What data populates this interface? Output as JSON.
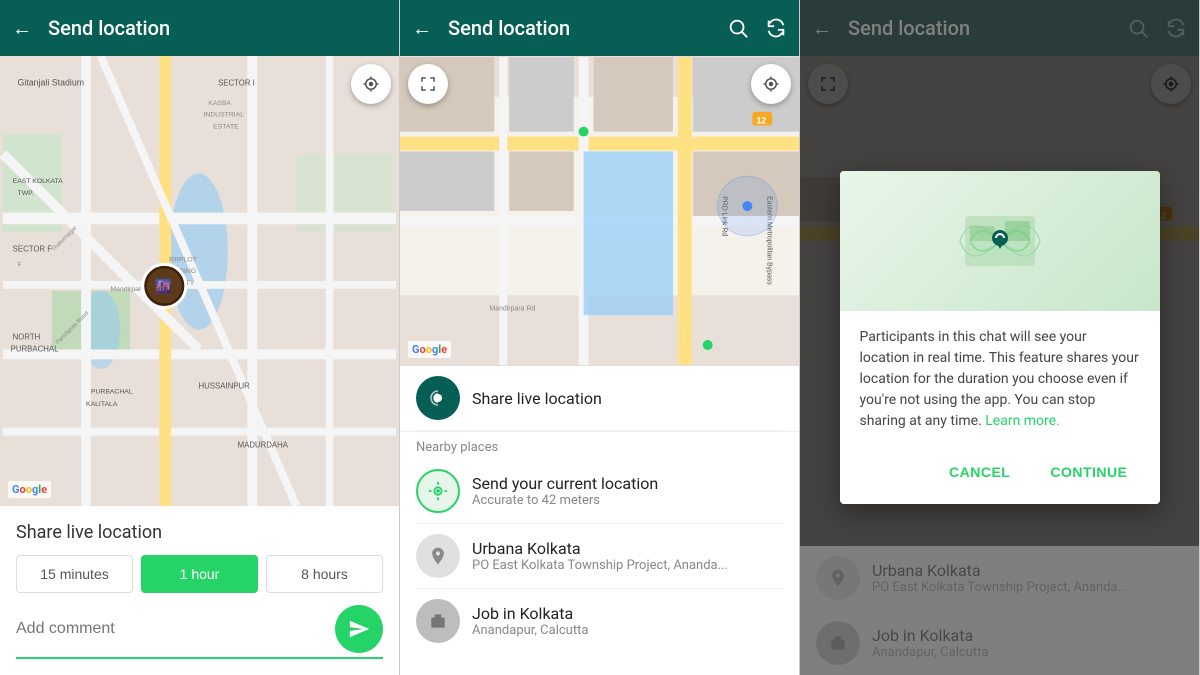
{
  "panel_left": {
    "header": {
      "title": "Send location",
      "back_icon": "←"
    },
    "section_title": "Share live location",
    "duration_options": [
      {
        "label": "15 minutes",
        "active": false
      },
      {
        "label": "1 hour",
        "active": true
      },
      {
        "label": "8 hours",
        "active": false
      }
    ],
    "comment_placeholder": "Add comment",
    "send_icon": "▶"
  },
  "panel_mid": {
    "header": {
      "title": "Send location",
      "back_icon": "←",
      "search_icon": "search",
      "refresh_icon": "refresh"
    },
    "live_location_label": "Share live location",
    "nearby_label": "Nearby places",
    "current_location": {
      "label": "Send your current location",
      "sublabel": "Accurate to 42 meters"
    },
    "places": [
      {
        "name": "Urbana Kolkata",
        "address": "PO East Kolkata Township Project, Ananda..."
      },
      {
        "name": "Job in Kolkata",
        "address": "Anandapur, Calcutta"
      }
    ]
  },
  "panel_right": {
    "header": {
      "title": "Send location",
      "back_icon": "←",
      "search_icon": "search",
      "refresh_icon": "refresh"
    },
    "dialog": {
      "body_text": "Participants in this chat will see your location in real time. This feature shares your location for the duration you choose even if you're not using the app. You can stop sharing at any time.",
      "learn_more": "Learn more.",
      "cancel_label": "CANCEL",
      "continue_label": "CONTINUE"
    },
    "places": [
      {
        "name": "Urbana Kolkata",
        "address": "PO East Kolkata Township Project, Ananda..."
      },
      {
        "name": "Job in Kolkata",
        "address": "Anandapur, Calcutta"
      }
    ]
  },
  "colors": {
    "teal": "#075e54",
    "green": "#25d366",
    "light_green": "#e8f5e9"
  }
}
